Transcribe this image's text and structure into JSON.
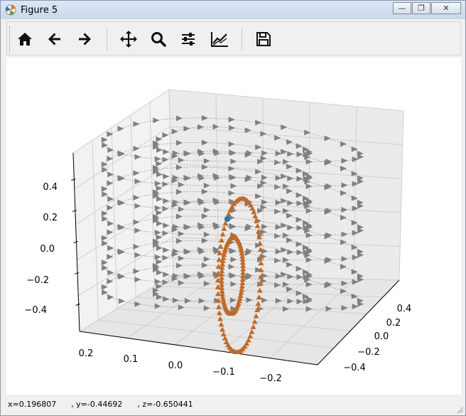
{
  "window": {
    "title": "Figure 5",
    "minimize": "—",
    "maximize": "❐",
    "close": "✕"
  },
  "toolbar": {
    "buttons": [
      {
        "name": "home",
        "tooltip": "Reset original view"
      },
      {
        "name": "back",
        "tooltip": "Back"
      },
      {
        "name": "forward",
        "tooltip": "Forward"
      },
      {
        "name": "pan",
        "tooltip": "Pan"
      },
      {
        "name": "zoom",
        "tooltip": "Zoom"
      },
      {
        "name": "subplots",
        "tooltip": "Configure subplots"
      },
      {
        "name": "customize",
        "tooltip": "Edit axis"
      },
      {
        "name": "save",
        "tooltip": "Save"
      }
    ]
  },
  "status": {
    "text": "x=0.196807      , y=-0.44692      , z=-0.650441"
  },
  "chart_data": {
    "type": "scatter",
    "projection": "3d",
    "colors": {
      "gray_series": "#808080",
      "orange_series": "#c06a28",
      "center_point": "#1f77b4"
    },
    "z_ticks": [
      "0.4",
      "0.2",
      "0.0",
      "−0.2",
      "−0.4"
    ],
    "x_ticks": [
      "0.2",
      "0.1",
      "0.0",
      "−0.1",
      "−0.2"
    ],
    "y_ticks": [
      "0.4",
      "0.2",
      "0.0",
      "−0.2",
      "−0.4"
    ],
    "zlim": [
      -0.5,
      0.5
    ],
    "xlim": [
      -0.25,
      0.25
    ],
    "ylim": [
      -0.5,
      0.5
    ],
    "grid": true,
    "series": [
      {
        "color": "#808080",
        "marker": "triangle-right",
        "shape": "stacked horizontal rings",
        "radius": [
          0.3,
          0.5
        ],
        "z_levels": [
          -0.45,
          -0.3,
          -0.15,
          0.0,
          0.15,
          0.3,
          0.45
        ]
      },
      {
        "color": "#c06a28",
        "marker": "triangle",
        "shape": "vertical loops",
        "radius": [
          0.1,
          0.3
        ]
      },
      {
        "color": "#1f77b4",
        "marker": "circle",
        "point": [
          0,
          0,
          0
        ]
      }
    ]
  }
}
